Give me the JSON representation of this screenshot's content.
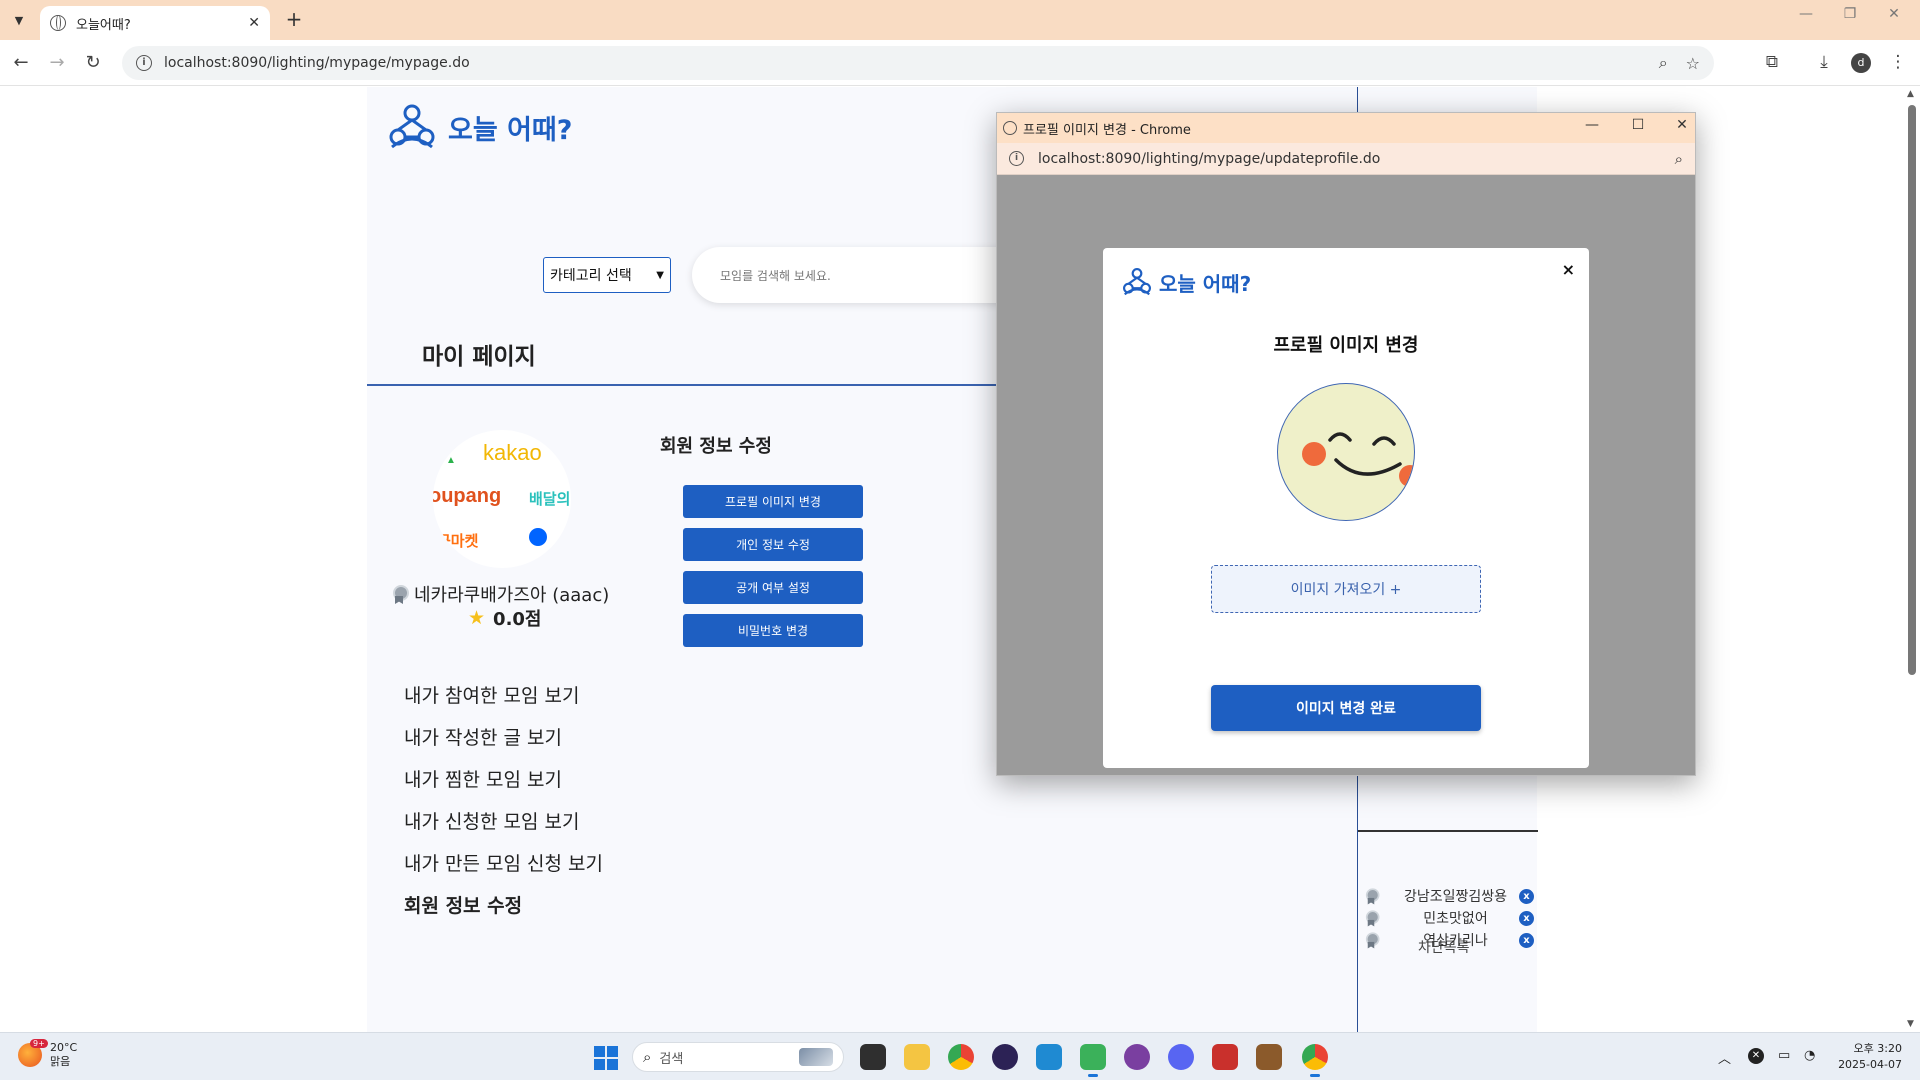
{
  "browser": {
    "tab_title": "오늘어때?",
    "url": "localhost:8090/lighting/mypage/mypage.do",
    "profile_initial": "d"
  },
  "site": {
    "logo_text": "오늘 어때?",
    "category_select": "카테고리 선택",
    "search_placeholder": "모임를 검색해 보세요."
  },
  "mypage": {
    "title": "마이 페이지",
    "avatar_logos": [
      "kakao",
      "oupang",
      "배달의",
      "근마켓"
    ],
    "username": "네카라쿠배가즈아 (aaac)",
    "score": "0.0점",
    "section_title": "회원 정보 수정",
    "buttons": [
      "프로필 이미지 변경",
      "개인 정보 수정",
      "공개 여부 설정",
      "비밀번호 변경"
    ],
    "menu": [
      "내가 참여한 모임 보기",
      "내가 작성한 글 보기",
      "내가 찜한 모임 보기",
      "내가 신청한 모임 보기",
      "내가 만든 모임 신청 보기",
      "회원 정보 수정"
    ]
  },
  "blocklist": {
    "title": "차단목록",
    "items": [
      "강남조일짱김쌍용",
      "민초맛없어",
      "역삼카리나"
    ],
    "remove_symbol": "x"
  },
  "popup": {
    "window_title": "프로필 이미지 변경 - Chrome",
    "url": "localhost:8090/lighting/mypage/updateprofile.do",
    "logo_text": "오늘 어때?",
    "close_symbol": "×",
    "modal_title": "프로필 이미지 변경",
    "import_button": "이미지 가져오기 +",
    "done_button": "이미지 변경 완료"
  },
  "taskbar": {
    "temperature": "20°C",
    "weather": "맑음",
    "weather_badge": "9+",
    "search_placeholder": "검색",
    "time": "오후 3:20",
    "date": "2025-04-07"
  },
  "colors": {
    "brand_blue": "#1e5fc2",
    "tab_bar": "#f9dcc3",
    "page_column": "#f8f9fd",
    "popup_overlay": "#9b9b9b"
  }
}
